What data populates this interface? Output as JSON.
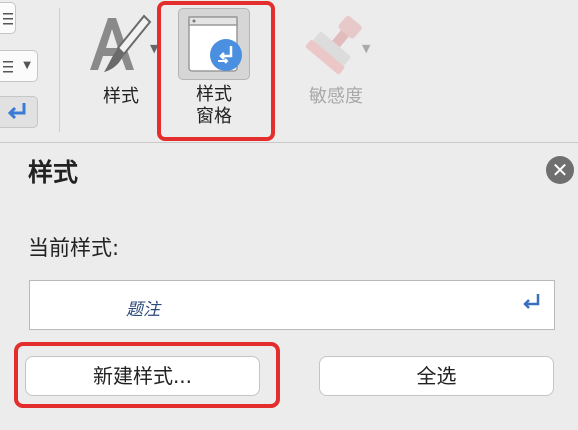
{
  "ribbon": {
    "styles_label": "样式",
    "style_pane_label_line1": "样式",
    "style_pane_label_line2": "窗格",
    "sensitivity_label": "敏感度"
  },
  "pane": {
    "title": "样式",
    "current_style_label": "当前样式:",
    "current_style_value": "题注",
    "new_style_button": "新建样式...",
    "select_all_button": "全选"
  },
  "colors": {
    "highlight": "#e42d2d",
    "accent_blue": "#4a8fe0",
    "close_bg": "#6f6f6f"
  },
  "icons": {
    "styles": "styles-brush-icon",
    "style_pane": "style-pane-icon",
    "sensitivity": "sensitivity-stamp-icon",
    "close": "close-icon",
    "paragraph_return": "return-arrow-icon"
  }
}
